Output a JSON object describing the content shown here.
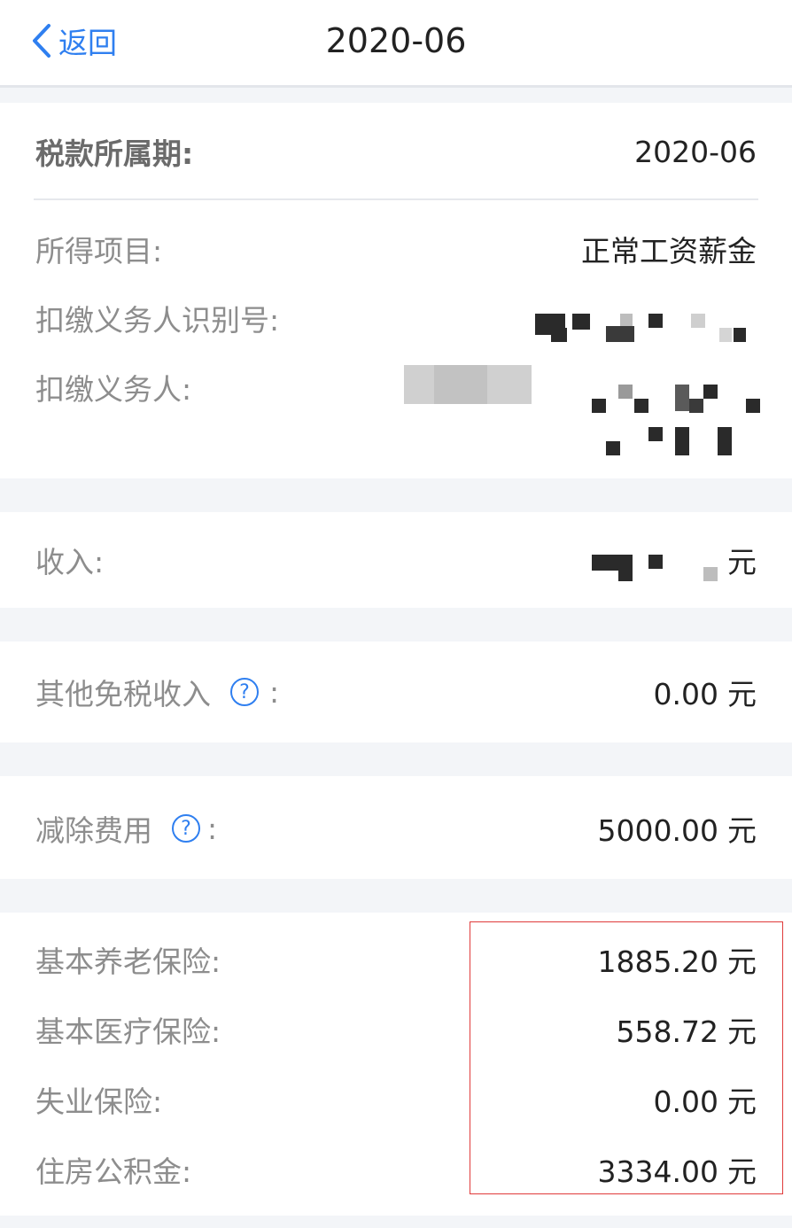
{
  "nav": {
    "back_label": "返回",
    "title": "2020-06"
  },
  "period": {
    "label": "税款所属期:",
    "value": "2020-06"
  },
  "income_item": {
    "label": "所得项目:",
    "value": "正常工资薪金"
  },
  "withholder_id": {
    "label": "扣缴义务人识别号:"
  },
  "withholder": {
    "label": "扣缴义务人:"
  },
  "income": {
    "label": "收入:",
    "unit": "元"
  },
  "tax_free": {
    "label": "其他免税收入",
    "help": "?",
    "colon": ":",
    "value": "0.00",
    "unit": "元"
  },
  "deduction": {
    "label": "减除费用",
    "help": "?",
    "colon": ":",
    "value": "5000.00",
    "unit": "元"
  },
  "insurance": [
    {
      "label": "基本养老保险:",
      "value": "1885.20",
      "unit": "元"
    },
    {
      "label": "基本医疗保险:",
      "value": "558.72",
      "unit": "元"
    },
    {
      "label": "失业保险:",
      "value": "0.00",
      "unit": "元"
    },
    {
      "label": "住房公积金:",
      "value": "3334.00",
      "unit": "元"
    }
  ]
}
